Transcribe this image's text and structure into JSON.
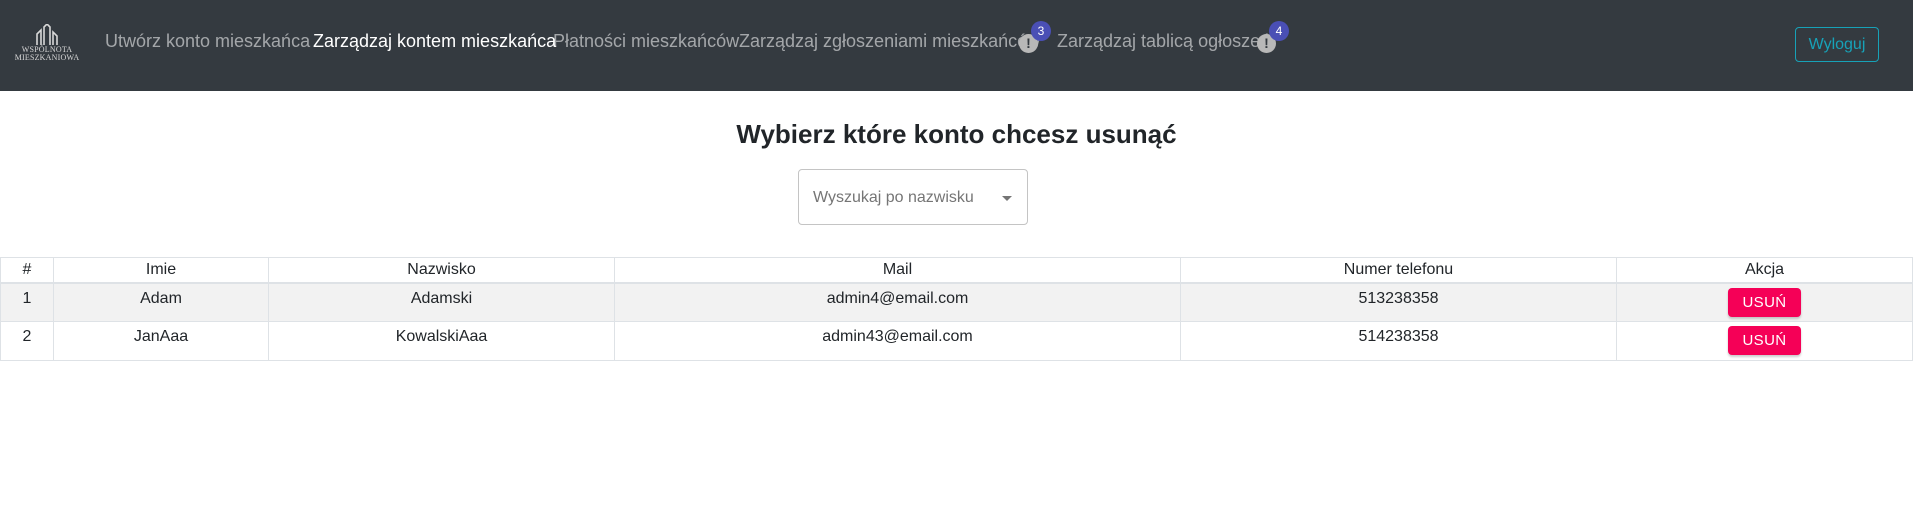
{
  "navbar": {
    "logo": {
      "line1": "WSPÓLNOTA",
      "line2": "MIESZKANIOWA"
    },
    "links": [
      {
        "label": "Utwórz konto mieszkańca",
        "active": false
      },
      {
        "label": "Zarządzaj kontem mieszkańca",
        "active": true
      },
      {
        "label": "Płatności mieszkańców",
        "active": false
      },
      {
        "label": "Zarządzaj zgłoszeniami mieszkańców",
        "active": false,
        "badge": "3",
        "icon": "exclamation-circle-icon"
      },
      {
        "label": "Zarządzaj tablicą ogłoszeń",
        "active": false,
        "badge": "4",
        "icon": "exclamation-circle-icon"
      }
    ],
    "logout_label": "Wyloguj"
  },
  "main": {
    "title": "Wybierz które konto chcesz usunąć",
    "search": {
      "placeholder": "Wyszukaj po nazwisku"
    }
  },
  "table": {
    "columns": [
      "#",
      "Imie",
      "Nazwisko",
      "Mail",
      "Numer telefonu",
      "Akcja"
    ],
    "rows": [
      {
        "num": "1",
        "first_name": "Adam",
        "last_name": "Adamski",
        "mail": "admin4@email.com",
        "phone": "513238358",
        "action": "USUŃ"
      },
      {
        "num": "2",
        "first_name": "JanAaa",
        "last_name": "KowalskiAaa",
        "mail": "admin43@email.com",
        "phone": "514238358",
        "action": "USUŃ"
      }
    ]
  },
  "colors": {
    "navbar_bg": "#343a40",
    "accent_info": "#17a2b8",
    "delete_button": "#f50057",
    "badge": "#4a4fb5"
  }
}
